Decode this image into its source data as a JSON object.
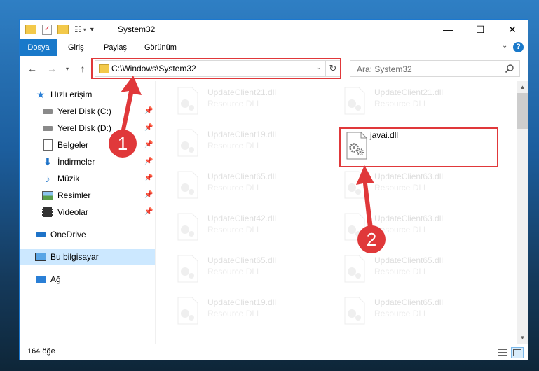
{
  "window": {
    "title": "System32",
    "minimize_label": "—",
    "maximize_label": "☐",
    "close_label": "✕"
  },
  "ribbon": {
    "tabs": [
      {
        "label": "Dosya",
        "active": true
      },
      {
        "label": "Giriş",
        "active": false
      },
      {
        "label": "Paylaş",
        "active": false
      },
      {
        "label": "Görünüm",
        "active": false
      }
    ],
    "expand_label": "⌄",
    "help_label": "?"
  },
  "address_bar": {
    "path": "C:\\Windows\\System32",
    "search_placeholder": "Ara: System32"
  },
  "nav_pane": {
    "items": [
      {
        "label": "Hızlı erişim",
        "icon": "star-icon",
        "pinned": false
      },
      {
        "label": "Yerel Disk (C:)",
        "icon": "drive-icon",
        "pinned": true
      },
      {
        "label": "Yerel Disk (D:)",
        "icon": "drive-icon",
        "pinned": true
      },
      {
        "label": "Belgeler",
        "icon": "document-icon",
        "pinned": true
      },
      {
        "label": "İndirmeler",
        "icon": "download-icon",
        "pinned": true
      },
      {
        "label": "Müzik",
        "icon": "music-icon",
        "pinned": true
      },
      {
        "label": "Resimler",
        "icon": "picture-icon",
        "pinned": true
      },
      {
        "label": "Videolar",
        "icon": "video-icon",
        "pinned": true
      },
      {
        "label": "OneDrive",
        "icon": "cloud-icon",
        "pinned": false
      },
      {
        "label": "Bu bilgisayar",
        "icon": "computer-icon",
        "pinned": false,
        "selected": true
      },
      {
        "label": "Ağ",
        "icon": "network-icon",
        "pinned": false
      }
    ]
  },
  "files": [
    {
      "name": "UpdateClient21.dll",
      "type": "Resource DLL",
      "faded": true
    },
    {
      "name": "UpdateClient21.dll",
      "type": "Resource DLL",
      "faded": true
    },
    {
      "name": "UpdateClient19.dll",
      "type": "Resource DLL",
      "faded": true
    },
    {
      "name": "javai.dll",
      "type": "",
      "faded": false
    },
    {
      "name": "UpdateClient65.dll",
      "type": "Resource DLL",
      "faded": true
    },
    {
      "name": "UpdateClient63.dll",
      "type": "Resource DLL",
      "faded": true
    },
    {
      "name": "UpdateClient42.dll",
      "type": "Resource DLL",
      "faded": true
    },
    {
      "name": "UpdateClient63.dll",
      "type": "Resource DLL",
      "faded": true
    },
    {
      "name": "UpdateClient65.dll",
      "type": "Resource DLL",
      "faded": true
    },
    {
      "name": "UpdateClient65.dll",
      "type": "Resource DLL",
      "faded": true
    },
    {
      "name": "UpdateClient19.dll",
      "type": "Resource DLL",
      "faded": true
    },
    {
      "name": "UpdateClient65.dll",
      "type": "Resource DLL",
      "faded": true
    }
  ],
  "status_bar": {
    "item_count": "164 öğe"
  },
  "annotations": {
    "step1": "1",
    "step2": "2",
    "color": "#e0383a"
  },
  "colors": {
    "accent": "#1979ca",
    "selection": "#cce8ff"
  }
}
